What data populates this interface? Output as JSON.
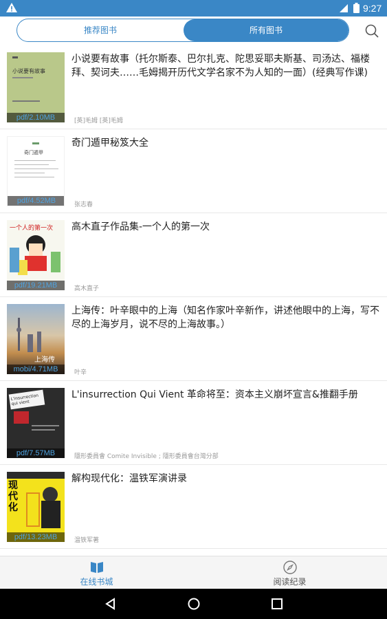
{
  "status_bar": {
    "time": "9:27"
  },
  "tabs": {
    "recommended": "推荐图书",
    "all": "所有图书"
  },
  "books": [
    {
      "title": "小说要有故事（托尔斯泰、巴尔扎克、陀思妥耶夫斯基、司汤达、福楼拜、契诃夫……毛姆揭开历代文学名家不为人知的一面）(经典写作课)",
      "author": "[英]毛姆 [英]毛姆",
      "badge": "pdf/2.10MB",
      "cover_text": "小说要有故事"
    },
    {
      "title": "奇门遁甲秘笈大全",
      "author": "张志春",
      "badge": "pdf/4.52MB",
      "cover_text": "奇门遁甲"
    },
    {
      "title": "高木直子作品集-一个人的第一次",
      "author": "高木直子",
      "badge": "pdf/19.21MB",
      "cover_text": "一个人的第一次"
    },
    {
      "title": "上海传：叶辛眼中的上海（知名作家叶辛新作，讲述他眼中的上海，写不尽的上海岁月，说不尽的上海故事。）",
      "author": "叶辛",
      "badge": "mobi/4.71MB",
      "cover_text": "上海传"
    },
    {
      "title": "L'insurrection Qui Vient 革命将至：资本主义崩坏宣言&推翻手册",
      "author": "隱形委員會 Comite Invisible ; 隱形委員會台灣分部",
      "badge": "pdf/7.57MB",
      "cover_text": "L'insurrection qui vient"
    },
    {
      "title": "解构现代化：温铁军演讲录",
      "author": "温铁军著",
      "badge": "pdf/13.23MB",
      "cover_text": "现代化"
    }
  ],
  "bottom_nav": {
    "store": "在线书城",
    "history": "阅读纪录"
  },
  "colors": {
    "accent": "#3a87c6",
    "badge_text": "#4fa3e0"
  }
}
